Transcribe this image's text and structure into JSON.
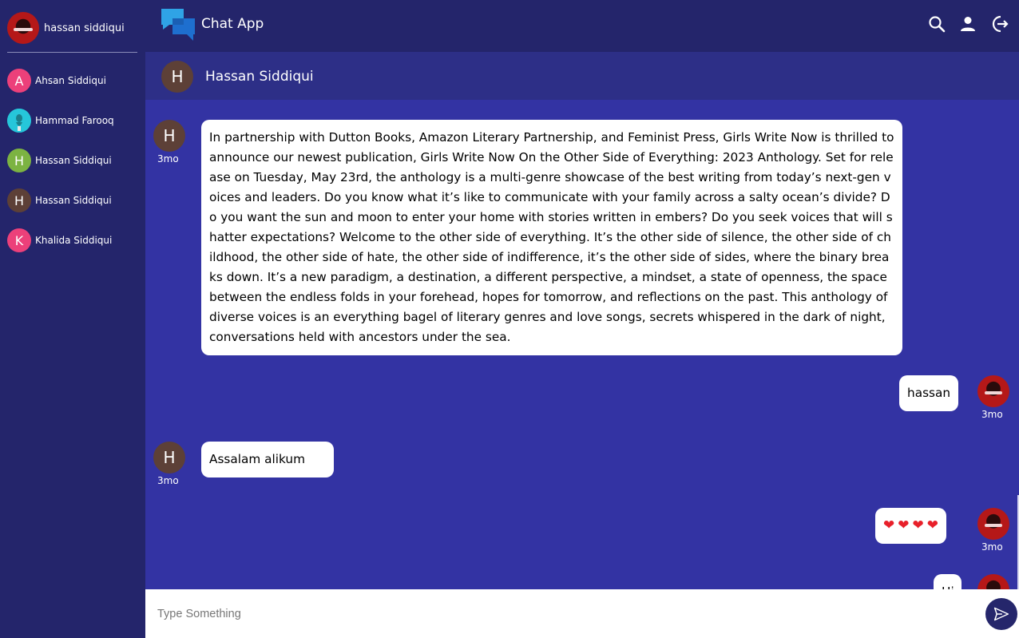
{
  "app": {
    "title": "Chat App",
    "current_user": "hassan siddiqui"
  },
  "sidebar": {
    "contacts": [
      {
        "initial": "A",
        "name": "Ahsan Siddiqui",
        "color": "#ec407a"
      },
      {
        "initial": "",
        "name": "Hammad Farooq",
        "color": "#26c6da",
        "icon": "photo-avatar"
      },
      {
        "initial": "H",
        "name": "Hassan Siddiqui",
        "color": "#7cb342"
      },
      {
        "initial": "H",
        "name": "Hassan Siddiqui",
        "color": "#5d4037"
      },
      {
        "initial": "K",
        "name": "Khalida Siddiqui",
        "color": "#ec407a"
      }
    ]
  },
  "header": {
    "icons": [
      "search-icon",
      "person-icon",
      "logout-icon"
    ]
  },
  "chat_header": {
    "initial": "H",
    "name": "Hassan Siddiqui"
  },
  "messages": [
    {
      "sender": "Hassan Siddiqui",
      "initial": "H",
      "side": "left",
      "time": "3mo",
      "text": "In partnership with Dutton Books, Amazon Literary Partnership, and Feminist Press, Girls Write Now is thrilled to announce our newest publication, Girls Write Now On the Other Side of Everything: 2023 Anthology. Set for release on Tuesday, May 23rd, the anthology is a multi-genre showcase of the best writing from today’s next-gen voices and leaders. Do you know what it’s like to communicate with your family across a salty ocean’s divide? Do you want the sun and moon to enter your home with stories written in embers? Do you seek voices that will shatter expectations? Welcome to the other side of everything. It’s the other side of silence, the other side of childhood, the other side of hate, the other side of indifference, it’s the other side of sides, where the binary breaks down. It’s a new paradigm, a destination, a different perspective, a mindset, a state of openness, the space between the endless folds in your forehead, hopes for tomorrow, and reflections on the past. This anthology of diverse voices is an everything bagel of literary genres and love songs, secrets whispered in the dark of night, conversations held with ancestors under the sea."
    },
    {
      "sender": "me",
      "side": "right",
      "time": "3mo",
      "text": "hassan"
    },
    {
      "sender": "Hassan Siddiqui",
      "initial": "H",
      "side": "left",
      "time": "3mo",
      "text": "Assalam alikum"
    },
    {
      "sender": "me",
      "side": "right",
      "time": "3mo",
      "text": "❤❤❤❤"
    },
    {
      "sender": "me",
      "side": "right",
      "time": "",
      "text": "Hi"
    }
  ],
  "composer": {
    "placeholder": "Type Something"
  }
}
